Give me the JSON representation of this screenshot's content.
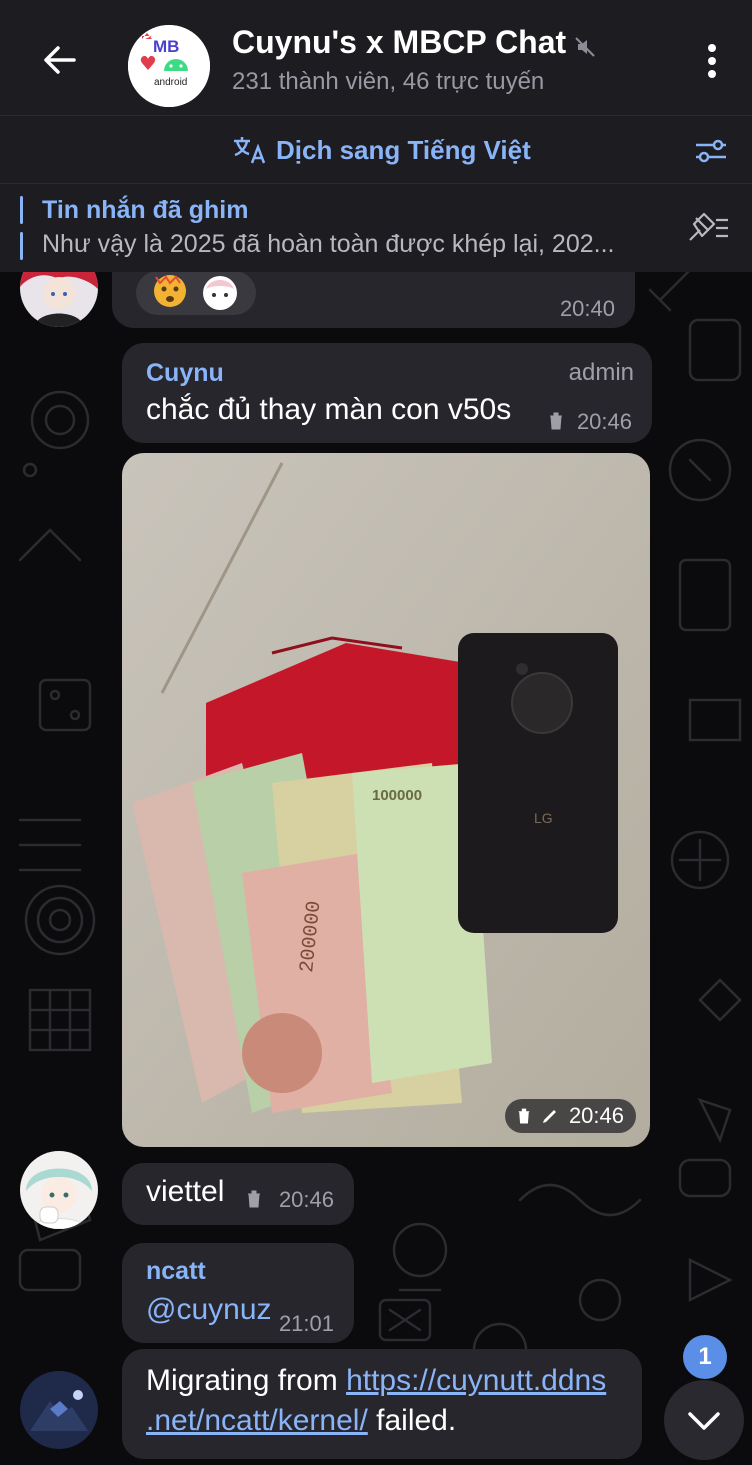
{
  "header": {
    "title": "Cuynu's x MBCP Chat",
    "subtitle": "231 thành viên, 46 trực tuyến",
    "avatar_mark": "MB",
    "avatar_word": "android"
  },
  "translate": {
    "label": "Dịch sang Tiếng Việt"
  },
  "pinned": {
    "title": "Tin nhắn đã ghim",
    "text": "Như vậy là 2025 đã hoàn toàn được khép lại, 202..."
  },
  "messages": [
    {
      "time": "20:40",
      "reactions": [
        "shocked-face-sticker",
        "anime-avatar-sticker"
      ]
    },
    {
      "sender": "Cuynu",
      "role": "admin",
      "text": "chắc đủ thay màn con v50s",
      "time": "20:46"
    },
    {
      "type": "photo",
      "time": "20:46",
      "photo_texts": [
        "100000",
        "200000",
        "LG"
      ]
    },
    {
      "text": "viettel",
      "time": "20:46"
    },
    {
      "sender": "ncatt",
      "text": "@cuynuz",
      "time": "21:01"
    },
    {
      "text_before": "Migrating from ",
      "link_line1": "https://cuynutt.ddns",
      "link_line2": ".net/ncatt/kernel/",
      "text_after": " failed."
    }
  ],
  "unread_count": "1",
  "colors": {
    "accent": "#8ab4f8",
    "bubble": "#27262c",
    "bar": "#1d1c21",
    "badge": "#5b8ee6"
  }
}
